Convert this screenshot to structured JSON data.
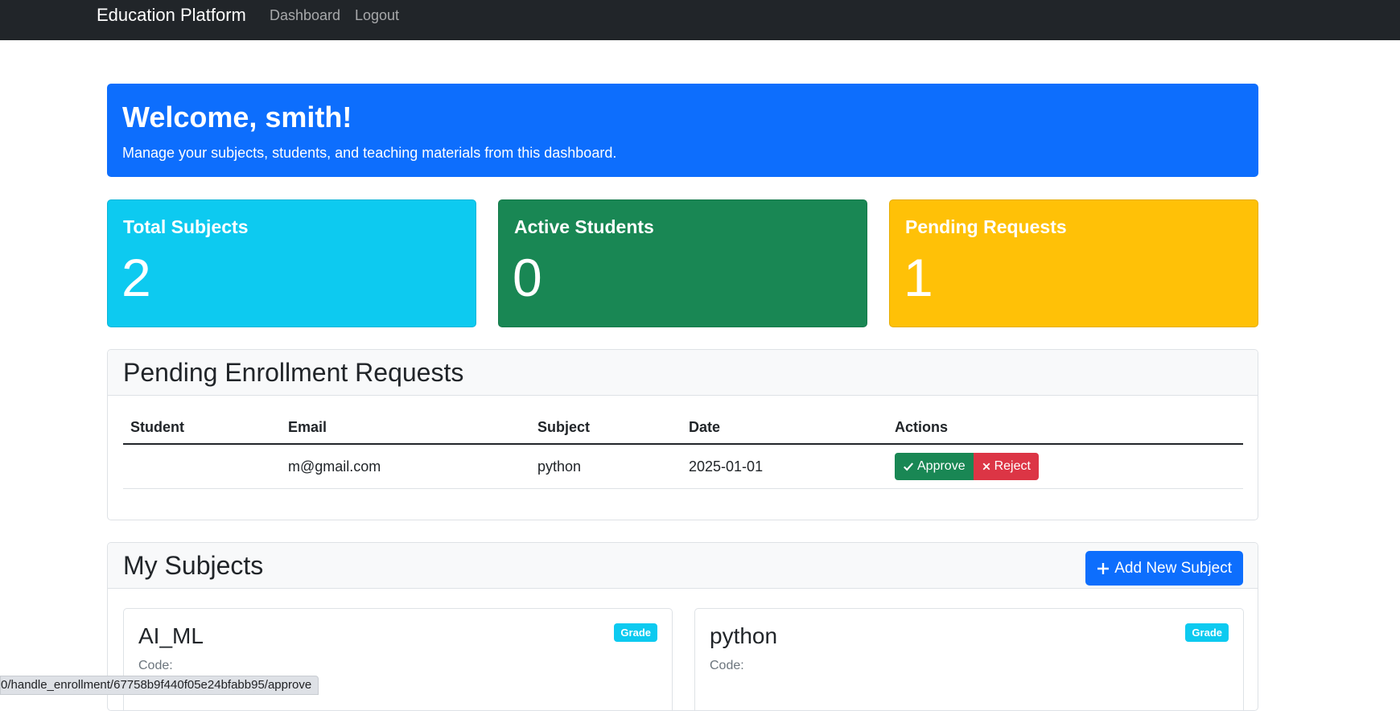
{
  "navbar": {
    "brand": "Education Platform",
    "links": [
      "Dashboard",
      "Logout"
    ]
  },
  "welcome": {
    "title": "Welcome, smith!",
    "subtitle": "Manage your subjects, students, and teaching materials from this dashboard."
  },
  "stats": [
    {
      "title": "Total Subjects",
      "value": "2",
      "color": "#0dcaf0"
    },
    {
      "title": "Active Students",
      "value": "0",
      "color": "#198754"
    },
    {
      "title": "Pending Requests",
      "value": "1",
      "color": "#ffc107"
    }
  ],
  "pending": {
    "title": "Pending Enrollment Requests",
    "columns": [
      "Student",
      "Email",
      "Subject",
      "Date",
      "Actions"
    ],
    "rows": [
      {
        "student": "",
        "email": "m@gmail.com",
        "subject": "python",
        "date": "2025-01-01",
        "approve": "Approve",
        "reject": "Reject"
      }
    ]
  },
  "subjects": {
    "title": "My Subjects",
    "add_button": "Add New Subject",
    "items": [
      {
        "name": "AI_ML",
        "code_label": "Code:",
        "badge": "Grade"
      },
      {
        "name": "python",
        "code_label": "Code:",
        "badge": "Grade"
      }
    ]
  },
  "statusbar": {
    "url": "0/handle_enrollment/67758b9f440f05e24bfabb95/approve"
  },
  "colors": {
    "primary": "#0d6efd",
    "info": "#0dcaf0",
    "success": "#198754",
    "warning": "#ffc107",
    "danger": "#dc3545",
    "dark": "#212529"
  },
  "icons": {
    "approve": "check-icon",
    "reject": "x-icon",
    "add": "plus-icon"
  }
}
